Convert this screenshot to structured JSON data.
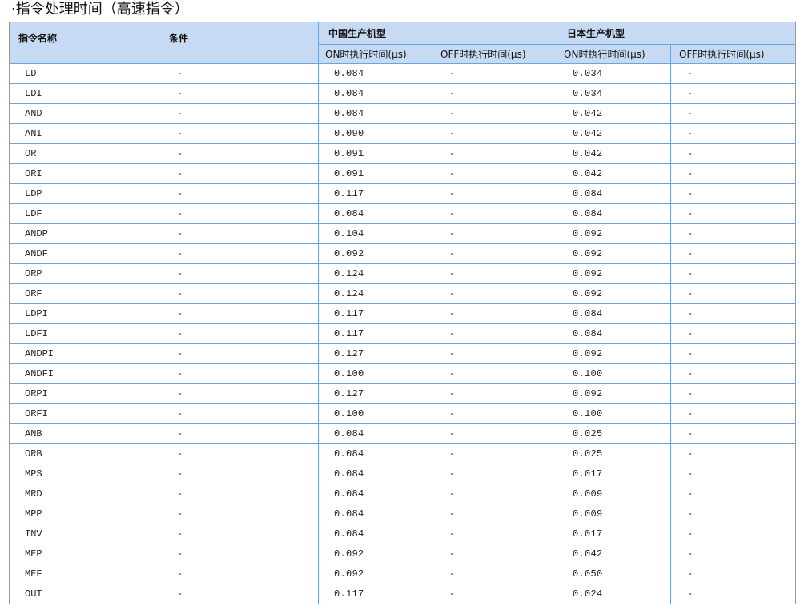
{
  "page": {
    "title": "·指令处理时间（高速指令）"
  },
  "colors": {
    "header_bg": "#c6dbf3",
    "border": "#6fa3d9"
  },
  "table": {
    "headers": {
      "instruction": "指令名称",
      "condition": "条件",
      "china_group": "中国生产机型",
      "japan_group": "日本生产机型",
      "china_on": "ON时执行时间(μs)",
      "china_off": "OFF时执行时间(μs)",
      "japan_on": "ON时执行时间(μs)",
      "japan_off": "OFF时执行时间(μs)"
    },
    "rows": [
      {
        "instruction": "LD",
        "condition": "-",
        "china_on": "0.084",
        "china_off": "-",
        "japan_on": "0.034",
        "japan_off": "-"
      },
      {
        "instruction": "LDI",
        "condition": "-",
        "china_on": "0.084",
        "china_off": "-",
        "japan_on": "0.034",
        "japan_off": "-"
      },
      {
        "instruction": "AND",
        "condition": "-",
        "china_on": "0.084",
        "china_off": "-",
        "japan_on": "0.042",
        "japan_off": "-"
      },
      {
        "instruction": "ANI",
        "condition": "-",
        "china_on": "0.090",
        "china_off": "-",
        "japan_on": "0.042",
        "japan_off": "-"
      },
      {
        "instruction": "OR",
        "condition": "-",
        "china_on": "0.091",
        "china_off": "-",
        "japan_on": "0.042",
        "japan_off": "-"
      },
      {
        "instruction": "ORI",
        "condition": "-",
        "china_on": "0.091",
        "china_off": "-",
        "japan_on": "0.042",
        "japan_off": "-"
      },
      {
        "instruction": "LDP",
        "condition": "-",
        "china_on": "0.117",
        "china_off": "-",
        "japan_on": "0.084",
        "japan_off": "-"
      },
      {
        "instruction": "LDF",
        "condition": "-",
        "china_on": "0.084",
        "china_off": "-",
        "japan_on": "0.084",
        "japan_off": "-"
      },
      {
        "instruction": "ANDP",
        "condition": "-",
        "china_on": "0.104",
        "china_off": "-",
        "japan_on": "0.092",
        "japan_off": "-"
      },
      {
        "instruction": "ANDF",
        "condition": "-",
        "china_on": "0.092",
        "china_off": "-",
        "japan_on": "0.092",
        "japan_off": "-"
      },
      {
        "instruction": "ORP",
        "condition": "-",
        "china_on": "0.124",
        "china_off": "-",
        "japan_on": "0.092",
        "japan_off": "-"
      },
      {
        "instruction": "ORF",
        "condition": "-",
        "china_on": "0.124",
        "china_off": "-",
        "japan_on": "0.092",
        "japan_off": "-"
      },
      {
        "instruction": "LDPI",
        "condition": "-",
        "china_on": "0.117",
        "china_off": "-",
        "japan_on": "0.084",
        "japan_off": "-"
      },
      {
        "instruction": "LDFI",
        "condition": "-",
        "china_on": "0.117",
        "china_off": "-",
        "japan_on": "0.084",
        "japan_off": "-"
      },
      {
        "instruction": "ANDPI",
        "condition": "-",
        "china_on": "0.127",
        "china_off": "-",
        "japan_on": "0.092",
        "japan_off": "-"
      },
      {
        "instruction": "ANDFI",
        "condition": "-",
        "china_on": "0.100",
        "china_off": "-",
        "japan_on": "0.100",
        "japan_off": "-"
      },
      {
        "instruction": "ORPI",
        "condition": "-",
        "china_on": "0.127",
        "china_off": "-",
        "japan_on": "0.092",
        "japan_off": "-"
      },
      {
        "instruction": "ORFI",
        "condition": "-",
        "china_on": "0.100",
        "china_off": "-",
        "japan_on": "0.100",
        "japan_off": "-"
      },
      {
        "instruction": "ANB",
        "condition": "-",
        "china_on": "0.084",
        "china_off": "-",
        "japan_on": "0.025",
        "japan_off": "-"
      },
      {
        "instruction": "ORB",
        "condition": "-",
        "china_on": "0.084",
        "china_off": "-",
        "japan_on": "0.025",
        "japan_off": "-"
      },
      {
        "instruction": "MPS",
        "condition": "-",
        "china_on": "0.084",
        "china_off": "-",
        "japan_on": "0.017",
        "japan_off": "-"
      },
      {
        "instruction": "MRD",
        "condition": "-",
        "china_on": "0.084",
        "china_off": "-",
        "japan_on": "0.009",
        "japan_off": "-"
      },
      {
        "instruction": "MPP",
        "condition": "-",
        "china_on": "0.084",
        "china_off": "-",
        "japan_on": "0.009",
        "japan_off": "-"
      },
      {
        "instruction": "INV",
        "condition": "-",
        "china_on": "0.084",
        "china_off": "-",
        "japan_on": "0.017",
        "japan_off": "-"
      },
      {
        "instruction": "MEP",
        "condition": "-",
        "china_on": "0.092",
        "china_off": "-",
        "japan_on": "0.042",
        "japan_off": "-"
      },
      {
        "instruction": "MEF",
        "condition": "-",
        "china_on": "0.092",
        "china_off": "-",
        "japan_on": "0.050",
        "japan_off": "-"
      },
      {
        "instruction": "OUT",
        "condition": "-",
        "china_on": "0.117",
        "china_off": "-",
        "japan_on": "0.024",
        "japan_off": "-"
      }
    ]
  }
}
